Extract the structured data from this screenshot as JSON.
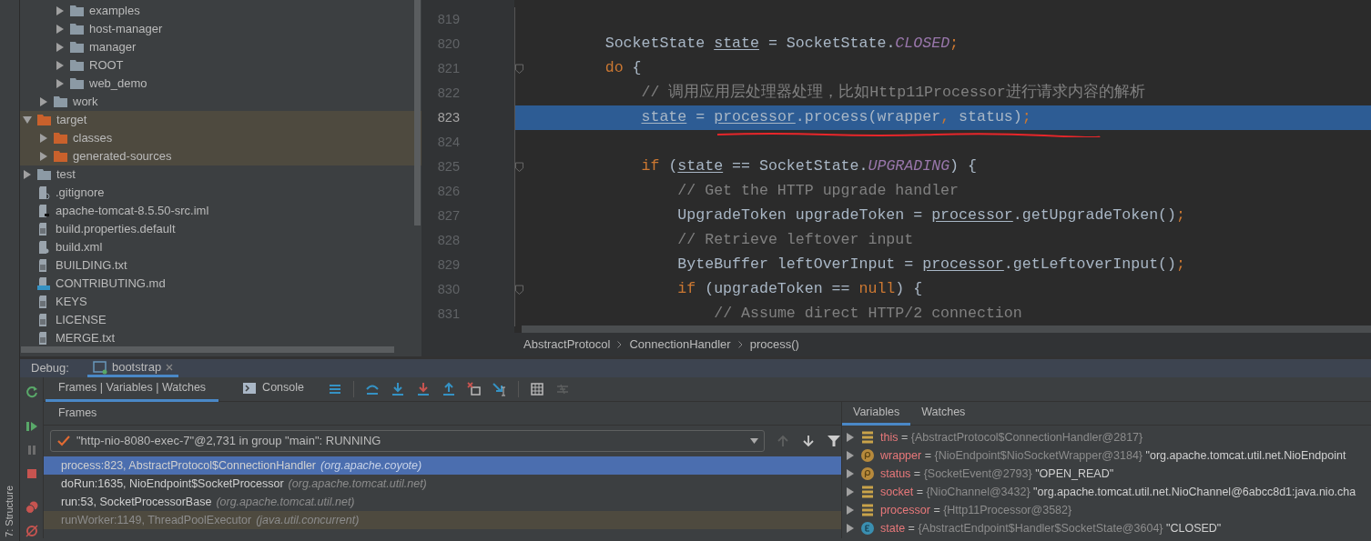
{
  "project_tree": {
    "items": [
      {
        "children": [
          {
            "children": [
              {
                "label": "examples",
                "kind": "folder",
                "expanded": false,
                "excluded": false
              },
              {
                "label": "host-manager",
                "kind": "folder",
                "expanded": false,
                "excluded": false
              },
              {
                "label": "manager",
                "kind": "folder",
                "expanded": false,
                "excluded": false
              },
              {
                "label": "ROOT",
                "kind": "folder",
                "expanded": false,
                "excluded": false
              },
              {
                "label": "web_demo",
                "kind": "folder",
                "expanded": false,
                "excluded": false
              }
            ]
          },
          {
            "label": "work",
            "kind": "folder",
            "expanded": false,
            "excluded": false
          }
        ]
      },
      {
        "label": "target",
        "kind": "folder",
        "expanded": true,
        "excluded": true,
        "children": [
          {
            "label": "classes",
            "kind": "folder",
            "expanded": false,
            "excluded": true
          },
          {
            "label": "generated-sources",
            "kind": "folder",
            "expanded": false,
            "excluded": true
          }
        ]
      },
      {
        "label": "test",
        "kind": "folder",
        "expanded": false,
        "excluded": false
      },
      {
        "label": ".gitignore",
        "kind": "ignore-file",
        "excluded": false
      },
      {
        "label": "apache-tomcat-8.5.50-src.iml",
        "kind": "module-file",
        "excluded": false
      },
      {
        "label": "build.properties.default",
        "kind": "text-file",
        "excluded": false
      },
      {
        "label": "build.xml",
        "kind": "ant-file",
        "excluded": false
      },
      {
        "label": "BUILDING.txt",
        "kind": "text-file",
        "excluded": false
      },
      {
        "label": "CONTRIBUTING.md",
        "kind": "markdown-file",
        "excluded": false
      },
      {
        "label": "KEYS",
        "kind": "text-file",
        "excluded": false
      },
      {
        "label": "LICENSE",
        "kind": "text-file",
        "excluded": false
      },
      {
        "label": "MERGE.txt",
        "kind": "text-file",
        "excluded": false
      }
    ]
  },
  "editor": {
    "lines": [
      {
        "number": "819",
        "current": false,
        "fold": false
      },
      {
        "number": "820",
        "current": false,
        "fold": false,
        "tokens": [
          {
            "kind": "plain",
            "text": "        SocketState "
          },
          {
            "kind": "underlined",
            "text": "state"
          },
          {
            "kind": "plain",
            "text": " = SocketState."
          },
          {
            "kind": "constant",
            "text": "CLOSED"
          },
          {
            "kind": "punct",
            "text": ";"
          }
        ]
      },
      {
        "number": "821",
        "current": false,
        "fold": true,
        "tokens": [
          {
            "kind": "keyword",
            "text": "        do"
          },
          {
            "kind": "plain",
            "text": " {"
          }
        ]
      },
      {
        "number": "822",
        "current": false,
        "fold": false,
        "tokens": [
          {
            "kind": "comment",
            "text": "            // 调用应用层处理器处理，比如Http11Processor进行请求内容的解析"
          }
        ]
      },
      {
        "number": "823",
        "current": true,
        "fold": false,
        "tokens": [
          {
            "kind": "underlined",
            "text": "            state"
          },
          {
            "kind": "plain",
            "text": " = "
          },
          {
            "kind": "underlined",
            "text": "processor"
          },
          {
            "kind": "plain",
            "text": ".process(wrapper"
          },
          {
            "kind": "punct",
            "text": ", "
          },
          {
            "kind": "plain",
            "text": "status)"
          },
          {
            "kind": "punct",
            "text": ";"
          }
        ]
      },
      {
        "number": "824",
        "current": false,
        "fold": false
      },
      {
        "number": "825",
        "current": false,
        "fold": true,
        "tokens": [
          {
            "kind": "keyword",
            "text": "            if"
          },
          {
            "kind": "plain",
            "text": " ("
          },
          {
            "kind": "underlined",
            "text": "state"
          },
          {
            "kind": "plain",
            "text": " == SocketState."
          },
          {
            "kind": "constant",
            "text": "UPGRADING"
          },
          {
            "kind": "plain",
            "text": ") {"
          }
        ]
      },
      {
        "number": "826",
        "current": false,
        "fold": false,
        "tokens": [
          {
            "kind": "comment",
            "text": "                // Get the HTTP upgrade handler"
          }
        ]
      },
      {
        "number": "827",
        "current": false,
        "fold": false,
        "tokens": [
          {
            "kind": "plain",
            "text": "                UpgradeToken upgradeToken = "
          },
          {
            "kind": "underlined",
            "text": "processor"
          },
          {
            "kind": "plain",
            "text": ".getUpgradeToken()"
          },
          {
            "kind": "punct",
            "text": ";"
          }
        ]
      },
      {
        "number": "828",
        "current": false,
        "fold": false,
        "tokens": [
          {
            "kind": "comment",
            "text": "                // Retrieve leftover input"
          }
        ]
      },
      {
        "number": "829",
        "current": false,
        "fold": false,
        "tokens": [
          {
            "kind": "plain",
            "text": "                ByteBuffer leftOverInput = "
          },
          {
            "kind": "underlined",
            "text": "processor"
          },
          {
            "kind": "plain",
            "text": ".getLeftoverInput()"
          },
          {
            "kind": "punct",
            "text": ";"
          }
        ]
      },
      {
        "number": "830",
        "current": false,
        "fold": true,
        "tokens": [
          {
            "kind": "keyword",
            "text": "                if"
          },
          {
            "kind": "plain",
            "text": " (upgradeToken == "
          },
          {
            "kind": "keyword",
            "text": "null"
          },
          {
            "kind": "plain",
            "text": ") {"
          }
        ]
      },
      {
        "number": "831",
        "current": false,
        "fold": false,
        "tokens": [
          {
            "kind": "comment",
            "text": "                    // Assume direct HTTP/2 connection"
          }
        ]
      }
    ],
    "breadcrumbs": [
      "AbstractProtocol",
      "ConnectionHandler",
      "process()"
    ]
  },
  "structure_tab": {
    "label": "7: Structure"
  },
  "debug": {
    "label": "Debug:",
    "tabs": [
      {
        "label": "bootstrap",
        "selected": true
      }
    ],
    "view_tabs": [
      {
        "label": "Frames | Variables | Watches",
        "kind": "frames",
        "selected": true
      },
      {
        "label": "Console",
        "kind": "console",
        "selected": false
      }
    ],
    "frames": {
      "title": "Frames",
      "thread": "\"http-nio-8080-exec-7\"@2,731 in group \"main\": RUNNING",
      "rows": [
        {
          "method": "process:823, AbstractProtocol$ConnectionHandler",
          "package": "(org.apache.coyote)",
          "selected": true,
          "library": false
        },
        {
          "method": "doRun:1635, NioEndpoint$SocketProcessor",
          "package": "(org.apache.tomcat.util.net)",
          "selected": false,
          "library": false
        },
        {
          "method": "run:53, SocketProcessorBase",
          "package": "(org.apache.tomcat.util.net)",
          "selected": false,
          "library": false
        },
        {
          "method": "runWorker:1149, ThreadPoolExecutor",
          "package": "(java.util.concurrent)",
          "selected": false,
          "library": true
        }
      ]
    },
    "variables": {
      "tabs": [
        {
          "label": "Variables",
          "selected": true
        },
        {
          "label": "Watches",
          "selected": false
        }
      ],
      "rows": [
        {
          "kind": "field",
          "name": "this",
          "separator": "=",
          "value": "{AbstractProtocol$ConnectionHandler@2817}"
        },
        {
          "kind": "parameter",
          "name": "wrapper",
          "separator": "=",
          "value": "{NioEndpoint$NioSocketWrapper@3184}",
          "string": "\"org.apache.tomcat.util.net.NioEndpoint"
        },
        {
          "kind": "parameter",
          "name": "status",
          "separator": "=",
          "value": "{SocketEvent@2793}",
          "string": "\"OPEN_READ\""
        },
        {
          "kind": "field",
          "name": "socket",
          "separator": "=",
          "value": "{NioChannel@3432}",
          "string": "\"org.apache.tomcat.util.net.NioChannel@6abcc8d1:java.nio.cha"
        },
        {
          "kind": "field",
          "name": "processor",
          "separator": "=",
          "value": "{Http11Processor@3582}"
        },
        {
          "kind": "enum",
          "name": "state",
          "separator": "=",
          "value": "{AbstractEndpoint$Handler$SocketState@3604}",
          "string": "\"CLOSED\""
        }
      ]
    }
  }
}
